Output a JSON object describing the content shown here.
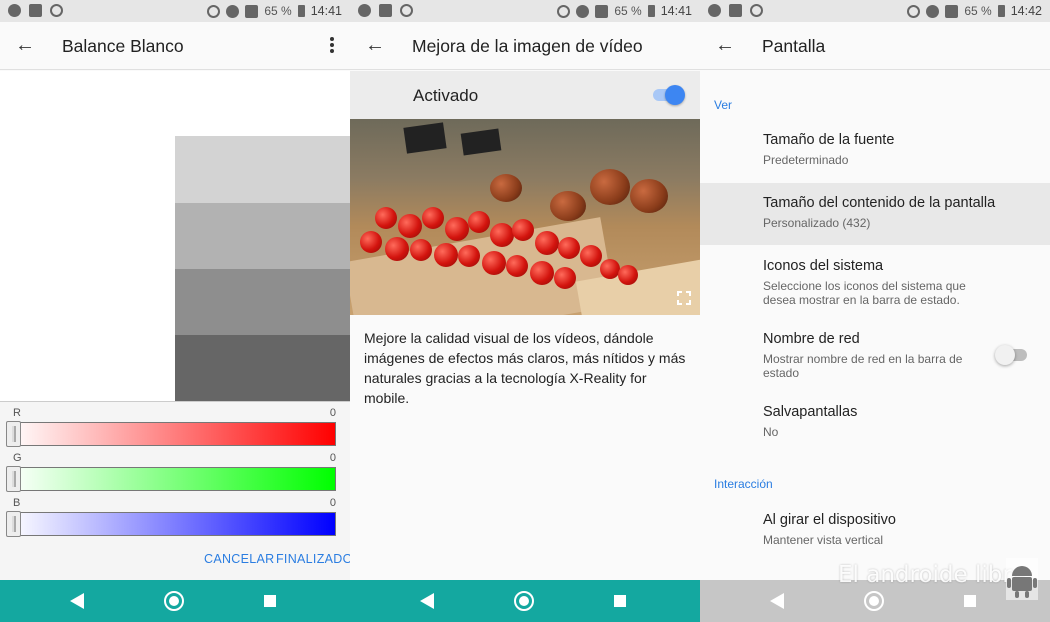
{
  "status": {
    "battery_screens": [
      "65 %",
      "65 %",
      "65 %"
    ],
    "times": [
      "14:41",
      "14:41",
      "14:42"
    ]
  },
  "screen1": {
    "title": "Balance Blanco",
    "swatches": [
      "#d3d3d3",
      "#b2b2b2",
      "#8e8e8e",
      "#666666"
    ],
    "channels": [
      {
        "label": "R",
        "value": "0",
        "color": "#ff0000",
        "level": 0
      },
      {
        "label": "G",
        "value": "0",
        "color": "#00ff00",
        "level": 0
      },
      {
        "label": "B",
        "value": "0",
        "color": "#0000ff",
        "level": 0
      }
    ],
    "cancel_label": "CANCELAR",
    "done_label": "FINALIZADO"
  },
  "screen2": {
    "title": "Mejora de la imagen de vídeo",
    "toggle_label": "Activado",
    "toggle_on": true,
    "description": "Mejore la calidad visual de los vídeos, dándole imágenes de efectos más claros, más nítidos y más naturales gracias a la tecnología X-Reality for mobile."
  },
  "screen3": {
    "title": "Pantalla",
    "category_ver": "Ver",
    "items": [
      {
        "title": "Tamaño de la fuente",
        "subtitle": "Predeterminado"
      },
      {
        "title": "Tamaño del contenido de la pantalla",
        "subtitle": "Personalizado (432)"
      },
      {
        "title": "Iconos del sistema",
        "subtitle": "Seleccione los iconos del sistema que desea mostrar en la barra de estado."
      },
      {
        "title": "Nombre de red",
        "subtitle": "Mostrar nombre de red en la barra de estado"
      },
      {
        "title": "Salvapantallas",
        "subtitle": "No"
      }
    ],
    "category_interaccion": "Interacción",
    "items2": [
      {
        "title": "Al girar el dispositivo",
        "subtitle": "Mantener vista vertical"
      }
    ],
    "watermark": "El androide libre"
  },
  "colors": {
    "accent": "#2a7de1",
    "navbar_teal": "#14a8a0",
    "navbar_gray": "#c6c6c6",
    "switch_on": "#3d86f2"
  }
}
